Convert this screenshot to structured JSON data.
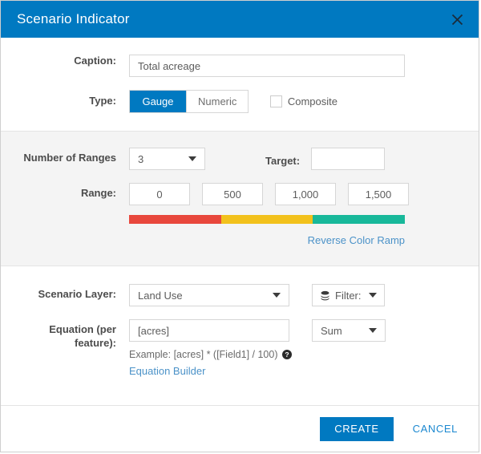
{
  "dialog": {
    "title": "Scenario Indicator",
    "close_icon": "close-icon",
    "accent_color": "#0079c1"
  },
  "caption": {
    "label": "Caption:",
    "value": "Total acreage",
    "placeholder": ""
  },
  "type": {
    "label": "Type:",
    "options": [
      "Gauge",
      "Numeric"
    ],
    "selected": "Gauge",
    "composite": {
      "label": "Composite",
      "checked": false
    }
  },
  "ranges": {
    "count_label": "Number of Ranges",
    "count_value": "3",
    "target_label": "Target:",
    "target_value": "",
    "range_label": "Range:",
    "range_values": [
      "0",
      "500",
      "1,000",
      "1,500"
    ],
    "ramp_colors": [
      "#e8473c",
      "#f2c11c",
      "#18b89a"
    ],
    "reverse_link": "Reverse Color Ramp"
  },
  "scenario_layer": {
    "label": "Scenario Layer:",
    "value": "Land Use",
    "filter_label": "Filter:",
    "filter_icon": "layers-stack-icon"
  },
  "equation": {
    "label_line1": "Equation (per",
    "label_line2": "feature):",
    "value": "[acres]",
    "aggregation": "Sum",
    "example_text": "Example: [acres] * ([Field1] / 100)",
    "help_icon": "help-circle-icon",
    "builder_link": "Equation Builder"
  },
  "footer": {
    "create_label": "CREATE",
    "cancel_label": "CANCEL"
  }
}
